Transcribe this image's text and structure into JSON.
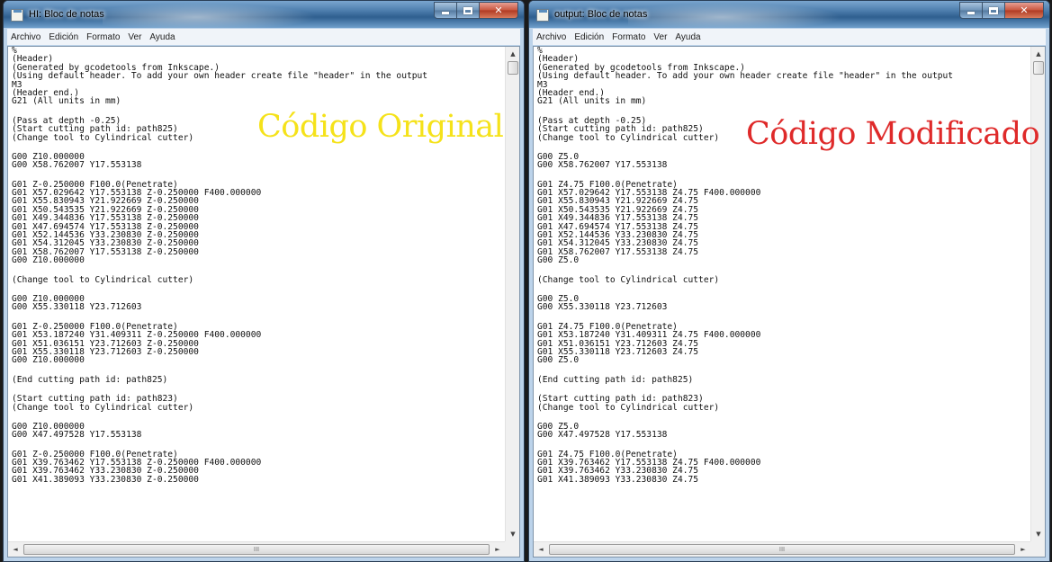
{
  "colors": {
    "original_label": "#f5e21a",
    "modified_label": "#df2a2a",
    "titlebar": "#4f7fae"
  },
  "menu": [
    "Archivo",
    "Edición",
    "Formato",
    "Ver",
    "Ayuda"
  ],
  "windows": [
    {
      "title": "HI: Bloc de notas",
      "overlay_label": "Código Original",
      "lines": [
        "%",
        "(Header)",
        "(Generated by gcodetools from Inkscape.)",
        "(Using default header. To add your own header create file \"header\" in the output",
        "M3",
        "(Header end.)",
        "G21 (All units in mm)",
        "",
        "(Pass at depth -0.25)",
        "(Start cutting path id: path825)",
        "(Change tool to Cylindrical cutter)",
        "",
        "G00 Z10.000000",
        "G00 X58.762007 Y17.553138",
        "",
        "G01 Z-0.250000 F100.0(Penetrate)",
        "G01 X57.029642 Y17.553138 Z-0.250000 F400.000000",
        "G01 X55.830943 Y21.922669 Z-0.250000",
        "G01 X50.543535 Y21.922669 Z-0.250000",
        "G01 X49.344836 Y17.553138 Z-0.250000",
        "G01 X47.694574 Y17.553138 Z-0.250000",
        "G01 X52.144536 Y33.230830 Z-0.250000",
        "G01 X54.312045 Y33.230830 Z-0.250000",
        "G01 X58.762007 Y17.553138 Z-0.250000",
        "G00 Z10.000000",
        "",
        "(Change tool to Cylindrical cutter)",
        "",
        "G00 Z10.000000",
        "G00 X55.330118 Y23.712603",
        "",
        "G01 Z-0.250000 F100.0(Penetrate)",
        "G01 X53.187240 Y31.409311 Z-0.250000 F400.000000",
        "G01 X51.036151 Y23.712603 Z-0.250000",
        "G01 X55.330118 Y23.712603 Z-0.250000",
        "G00 Z10.000000",
        "",
        "(End cutting path id: path825)",
        "",
        "(Start cutting path id: path823)",
        "(Change tool to Cylindrical cutter)",
        "",
        "G00 Z10.000000",
        "G00 X47.497528 Y17.553138",
        "",
        "G01 Z-0.250000 F100.0(Penetrate)",
        "G01 X39.763462 Y17.553138 Z-0.250000 F400.000000",
        "G01 X39.763462 Y33.230830 Z-0.250000",
        "G01 X41.389093 Y33.230830 Z-0.250000"
      ]
    },
    {
      "title": "output: Bloc de notas",
      "overlay_label": "Código Modificado",
      "lines": [
        "%",
        "(Header)",
        "(Generated by gcodetools from Inkscape.)",
        "(Using default header. To add your own header create file \"header\" in the output",
        "M3",
        "(Header end.)",
        "G21 (All units in mm)",
        "",
        "(Pass at depth -0.25)",
        "(Start cutting path id: path825)",
        "(Change tool to Cylindrical cutter)",
        "",
        "G00 Z5.0",
        "G00 X58.762007 Y17.553138",
        "",
        "G01 Z4.75 F100.0(Penetrate)",
        "G01 X57.029642 Y17.553138 Z4.75 F400.000000",
        "G01 X55.830943 Y21.922669 Z4.75",
        "G01 X50.543535 Y21.922669 Z4.75",
        "G01 X49.344836 Y17.553138 Z4.75",
        "G01 X47.694574 Y17.553138 Z4.75",
        "G01 X52.144536 Y33.230830 Z4.75",
        "G01 X54.312045 Y33.230830 Z4.75",
        "G01 X58.762007 Y17.553138 Z4.75",
        "G00 Z5.0",
        "",
        "(Change tool to Cylindrical cutter)",
        "",
        "G00 Z5.0",
        "G00 X55.330118 Y23.712603",
        "",
        "G01 Z4.75 F100.0(Penetrate)",
        "G01 X53.187240 Y31.409311 Z4.75 F400.000000",
        "G01 X51.036151 Y23.712603 Z4.75",
        "G01 X55.330118 Y23.712603 Z4.75",
        "G00 Z5.0",
        "",
        "(End cutting path id: path825)",
        "",
        "(Start cutting path id: path823)",
        "(Change tool to Cylindrical cutter)",
        "",
        "G00 Z5.0",
        "G00 X47.497528 Y17.553138",
        "",
        "G01 Z4.75 F100.0(Penetrate)",
        "G01 X39.763462 Y17.553138 Z4.75 F400.000000",
        "G01 X39.763462 Y33.230830 Z4.75",
        "G01 X41.389093 Y33.230830 Z4.75"
      ]
    }
  ],
  "scrollbar": {
    "up": "▲",
    "down": "▼",
    "left": "◄",
    "right": "►",
    "grip": "III"
  }
}
